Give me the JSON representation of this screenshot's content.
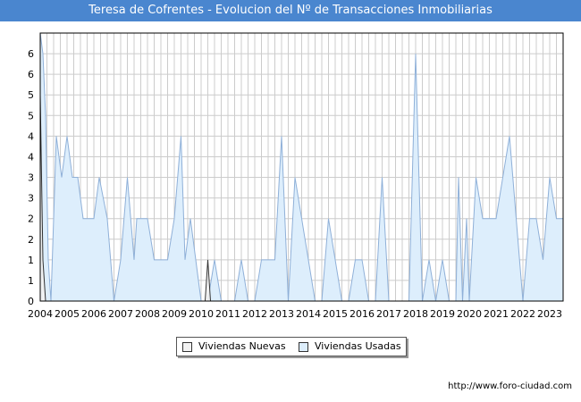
{
  "title": "Teresa de Cofrentes - Evolucion del Nº de Transacciones Inmobiliarias",
  "url": "http://www.foro-ciudad.com",
  "chart_data": {
    "type": "area",
    "title": "Teresa de Cofrentes - Evolucion del Nº de Transacciones Inmobiliarias",
    "xlabel": "",
    "ylabel": "",
    "x_ticks": [
      "2004",
      "2005",
      "2006",
      "2007",
      "2008",
      "2009",
      "2010",
      "2011",
      "2012",
      "2013",
      "2014",
      "2015",
      "2016",
      "2017",
      "2018",
      "2019",
      "2020",
      "2021",
      "2022",
      "2023"
    ],
    "y_ticks": [
      "0",
      "1",
      "1",
      "2",
      "2",
      "3",
      "3",
      "4",
      "4",
      "5",
      "5",
      "6",
      "6"
    ],
    "xlim": [
      2004.0,
      2023.5
    ],
    "ylim": [
      0,
      6.5
    ],
    "grid": true,
    "legend": "bottom-center",
    "colors": {
      "nuevas_fill": "#f2f2f2",
      "nuevas_line": "#333333",
      "usadas_fill": "#ddeefc",
      "usadas_line": "#8fb0d8",
      "title_bar": "#4a86cf"
    },
    "series": [
      {
        "name": "Viviendas Nuevas",
        "x": [
          2004.0,
          2004.1,
          2004.2,
          2010.15,
          2010.25,
          2010.35
        ],
        "values": [
          5,
          1,
          0,
          0,
          1,
          0
        ]
      },
      {
        "name": "Viviendas Usadas",
        "x": [
          2004.0,
          2004.1,
          2004.2,
          2004.3,
          2004.4,
          2004.5,
          2004.6,
          2004.8,
          2005.0,
          2005.2,
          2005.4,
          2005.6,
          2005.8,
          2006.0,
          2006.2,
          2006.5,
          2006.75,
          2007.0,
          2007.25,
          2007.5,
          2007.6,
          2007.8,
          2008.0,
          2008.25,
          2008.5,
          2008.75,
          2009.0,
          2009.25,
          2009.4,
          2009.6,
          2009.8,
          2010.0,
          2010.25,
          2010.5,
          2010.75,
          2011.0,
          2011.25,
          2011.5,
          2011.75,
          2012.0,
          2012.25,
          2012.5,
          2012.75,
          2013.0,
          2013.25,
          2013.5,
          2013.75,
          2014.0,
          2014.25,
          2014.5,
          2014.75,
          2015.0,
          2015.25,
          2015.5,
          2015.75,
          2016.0,
          2016.25,
          2016.5,
          2016.75,
          2017.0,
          2017.25,
          2017.5,
          2017.75,
          2018.0,
          2018.25,
          2018.5,
          2018.75,
          2019.0,
          2019.25,
          2019.5,
          2019.6,
          2019.75,
          2019.9,
          2020.0,
          2020.25,
          2020.5,
          2020.75,
          2021.0,
          2021.25,
          2021.5,
          2021.75,
          2022.0,
          2022.25,
          2022.5,
          2022.75,
          2023.0,
          2023.25,
          2023.5
        ],
        "values": [
          6.5,
          6,
          4.5,
          1,
          0,
          2,
          4,
          3,
          4,
          3,
          3,
          2,
          2,
          2,
          3,
          2,
          0,
          1,
          3,
          1,
          2,
          2,
          2,
          1,
          1,
          1,
          2,
          4,
          1,
          2,
          1,
          0,
          0,
          1,
          0,
          0,
          0,
          1,
          0,
          0,
          1,
          1,
          1,
          4,
          0,
          3,
          2,
          1,
          0,
          0,
          2,
          1,
          0,
          0,
          1,
          1,
          0,
          0,
          3,
          0,
          0,
          0,
          0,
          6,
          0,
          1,
          0,
          1,
          0,
          0,
          3,
          0,
          2,
          0,
          3,
          2,
          2,
          2,
          3,
          4,
          2,
          0,
          2,
          2,
          1,
          3,
          2,
          2
        ]
      }
    ]
  },
  "legend": {
    "items": [
      {
        "label": "Viviendas Nuevas",
        "color": "#f2f2f2"
      },
      {
        "label": "Viviendas Usadas",
        "color": "#ddeefc"
      }
    ]
  }
}
